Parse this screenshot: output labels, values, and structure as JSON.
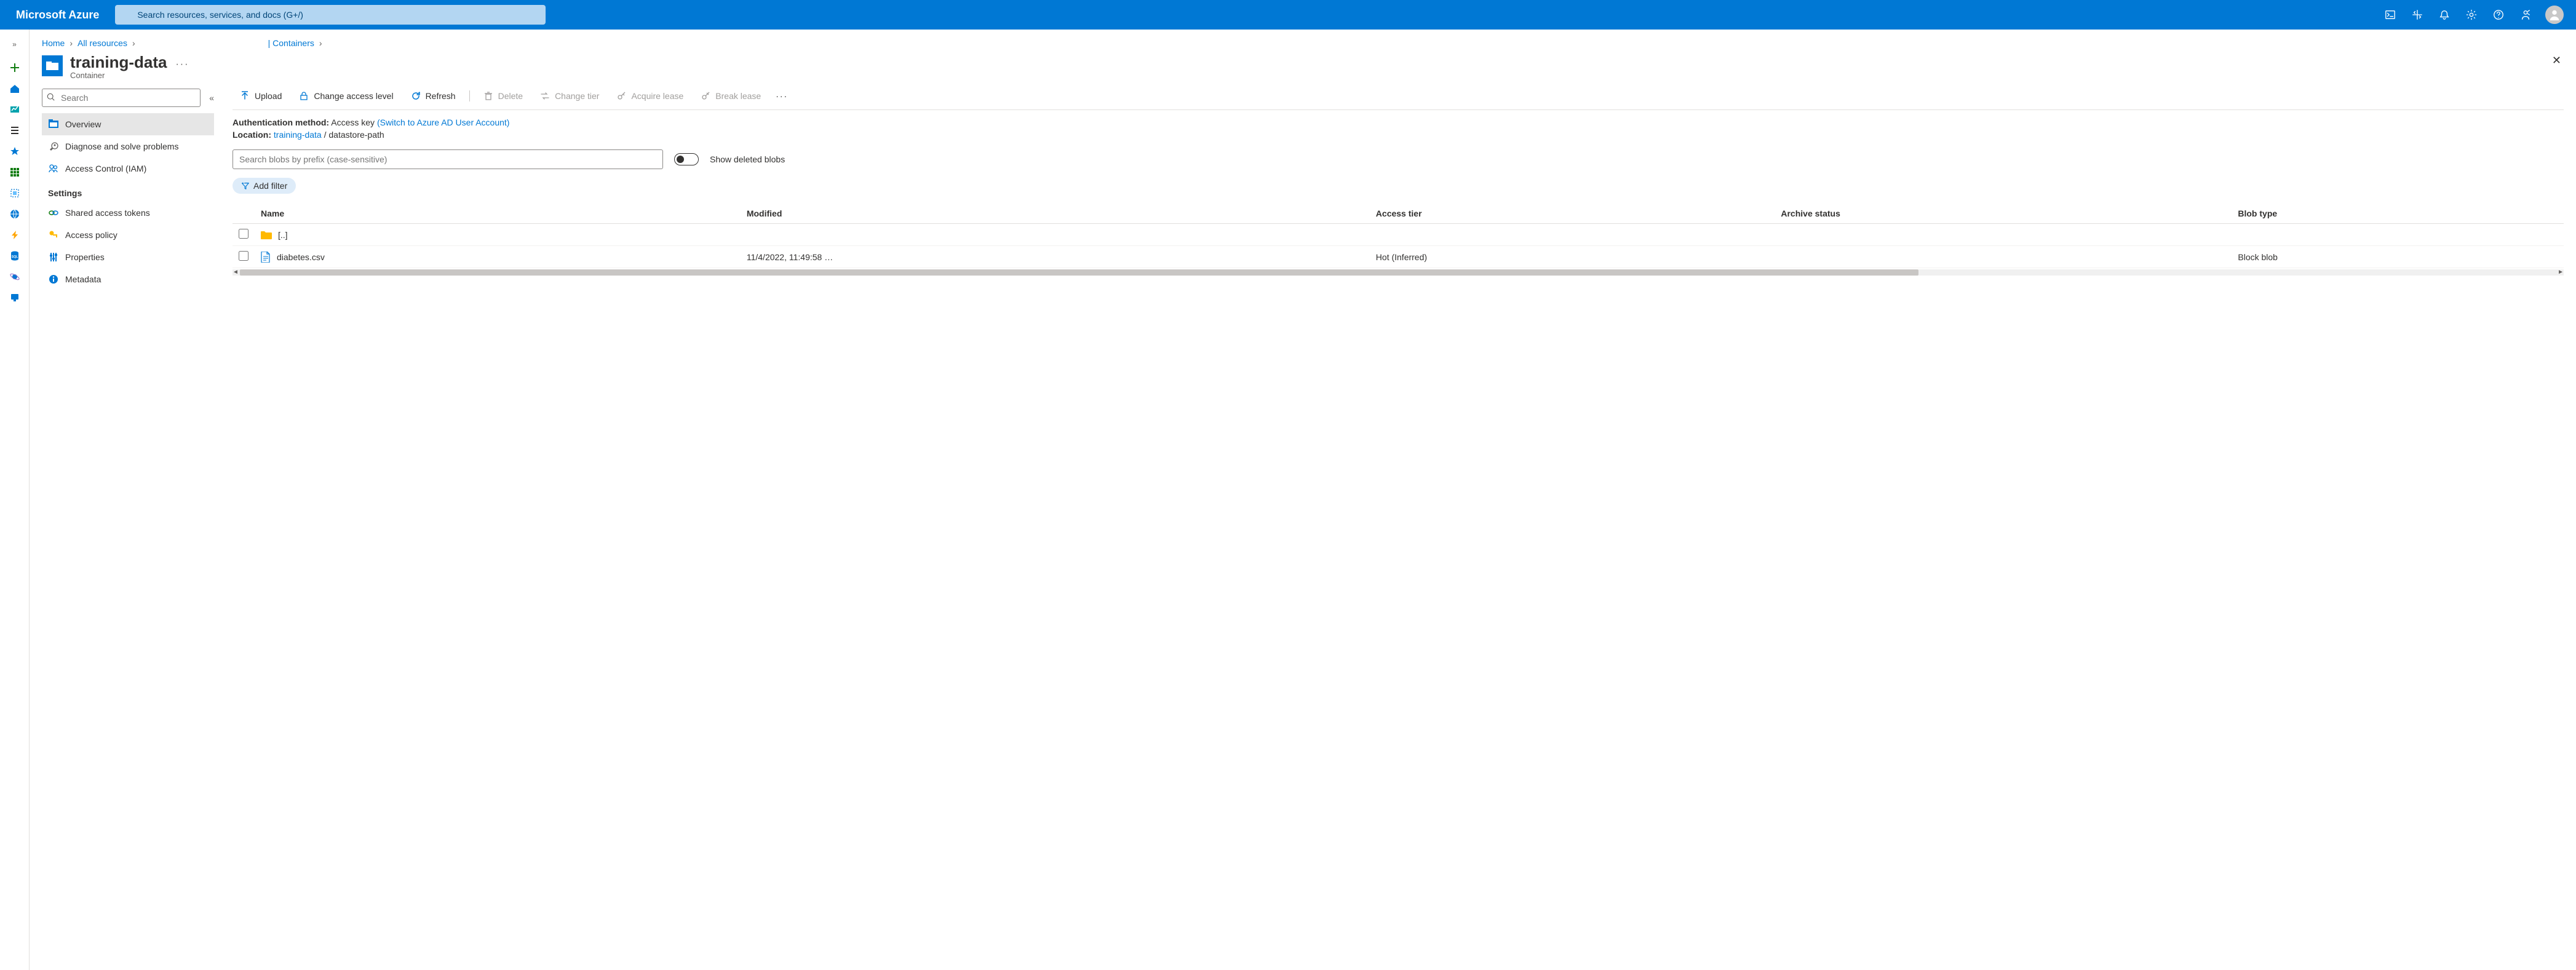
{
  "header": {
    "brand": "Microsoft Azure",
    "search_placeholder": "Search resources, services, and docs (G+/)"
  },
  "breadcrumb": {
    "home": "Home",
    "all_resources": "All resources",
    "containers": "| Containers"
  },
  "title": {
    "name": "training-data",
    "subtitle": "Container"
  },
  "sidemenu": {
    "search_placeholder": "Search",
    "items": {
      "overview": "Overview",
      "diagnose": "Diagnose and solve problems",
      "iam": "Access Control (IAM)"
    },
    "section_settings": "Settings",
    "settings": {
      "shared": "Shared access tokens",
      "policy": "Access policy",
      "properties": "Properties",
      "metadata": "Metadata"
    }
  },
  "toolbar": {
    "upload": "Upload",
    "change_access": "Change access level",
    "refresh": "Refresh",
    "delete": "Delete",
    "change_tier": "Change tier",
    "acquire_lease": "Acquire lease",
    "break_lease": "Break lease"
  },
  "info": {
    "auth_label": "Authentication method:",
    "auth_value": "Access key",
    "auth_switch": "(Switch to Azure AD User Account)",
    "location_label": "Location:",
    "location_link": "training-data",
    "location_path": "datastore-path"
  },
  "blob_search_placeholder": "Search blobs by prefix (case-sensitive)",
  "toggle_label": "Show deleted blobs",
  "add_filter": "Add filter",
  "table": {
    "headers": {
      "name": "Name",
      "modified": "Modified",
      "access_tier": "Access tier",
      "archive_status": "Archive status",
      "blob_type": "Blob type"
    },
    "rows": [
      {
        "name": "[..]",
        "modified": "",
        "access_tier": "",
        "archive_status": "",
        "blob_type": "",
        "kind": "folder"
      },
      {
        "name": "diabetes.csv",
        "modified": "11/4/2022, 11:49:58 …",
        "access_tier": "Hot (Inferred)",
        "archive_status": "",
        "blob_type": "Block blob",
        "kind": "file"
      }
    ]
  }
}
